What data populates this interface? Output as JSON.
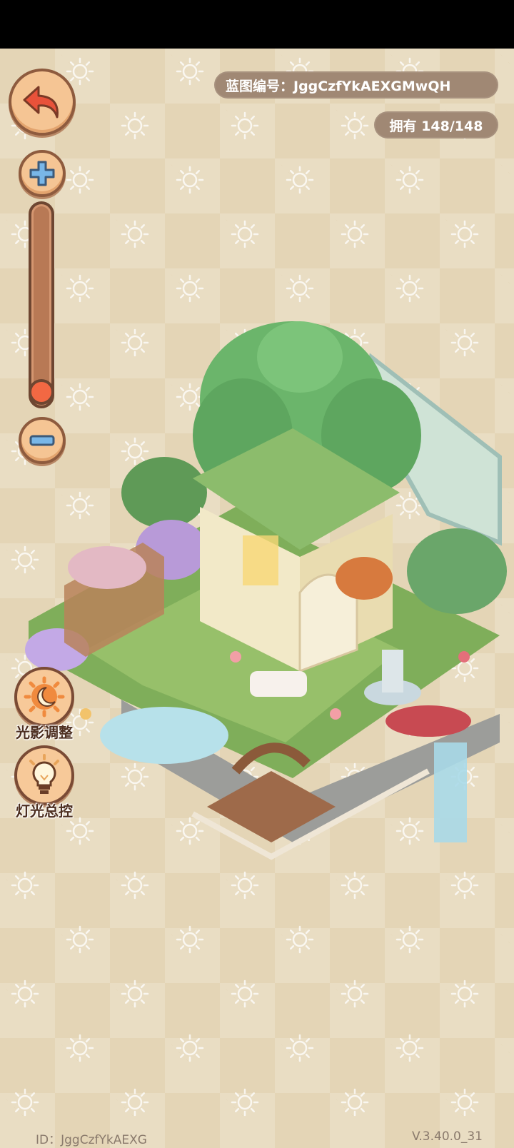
{
  "header": {
    "blueprint_label": "蓝图编号：JggCzfYkAEXGMwQH",
    "owned_label": "拥有 148/148"
  },
  "controls": {
    "back_icon": "back-arrow-icon",
    "zoom_in_icon": "plus-icon",
    "zoom_out_icon": "minus-icon",
    "zoom_level": 0.02
  },
  "side_buttons": {
    "light_shadow": {
      "label": "光影调整",
      "icon": "sun-moon-icon"
    },
    "light_control": {
      "label": "灯光总控",
      "icon": "lightbulb-icon"
    }
  },
  "footer": {
    "id_text": "ID：JggCzfYkAEXG",
    "version": "V.3.40.0_31"
  },
  "colors": {
    "background": "#e4d5b6",
    "pill": "#a08874",
    "button_fill": "#f5c594",
    "button_border": "#8e5b3e",
    "slider_knob": "#f26843"
  }
}
